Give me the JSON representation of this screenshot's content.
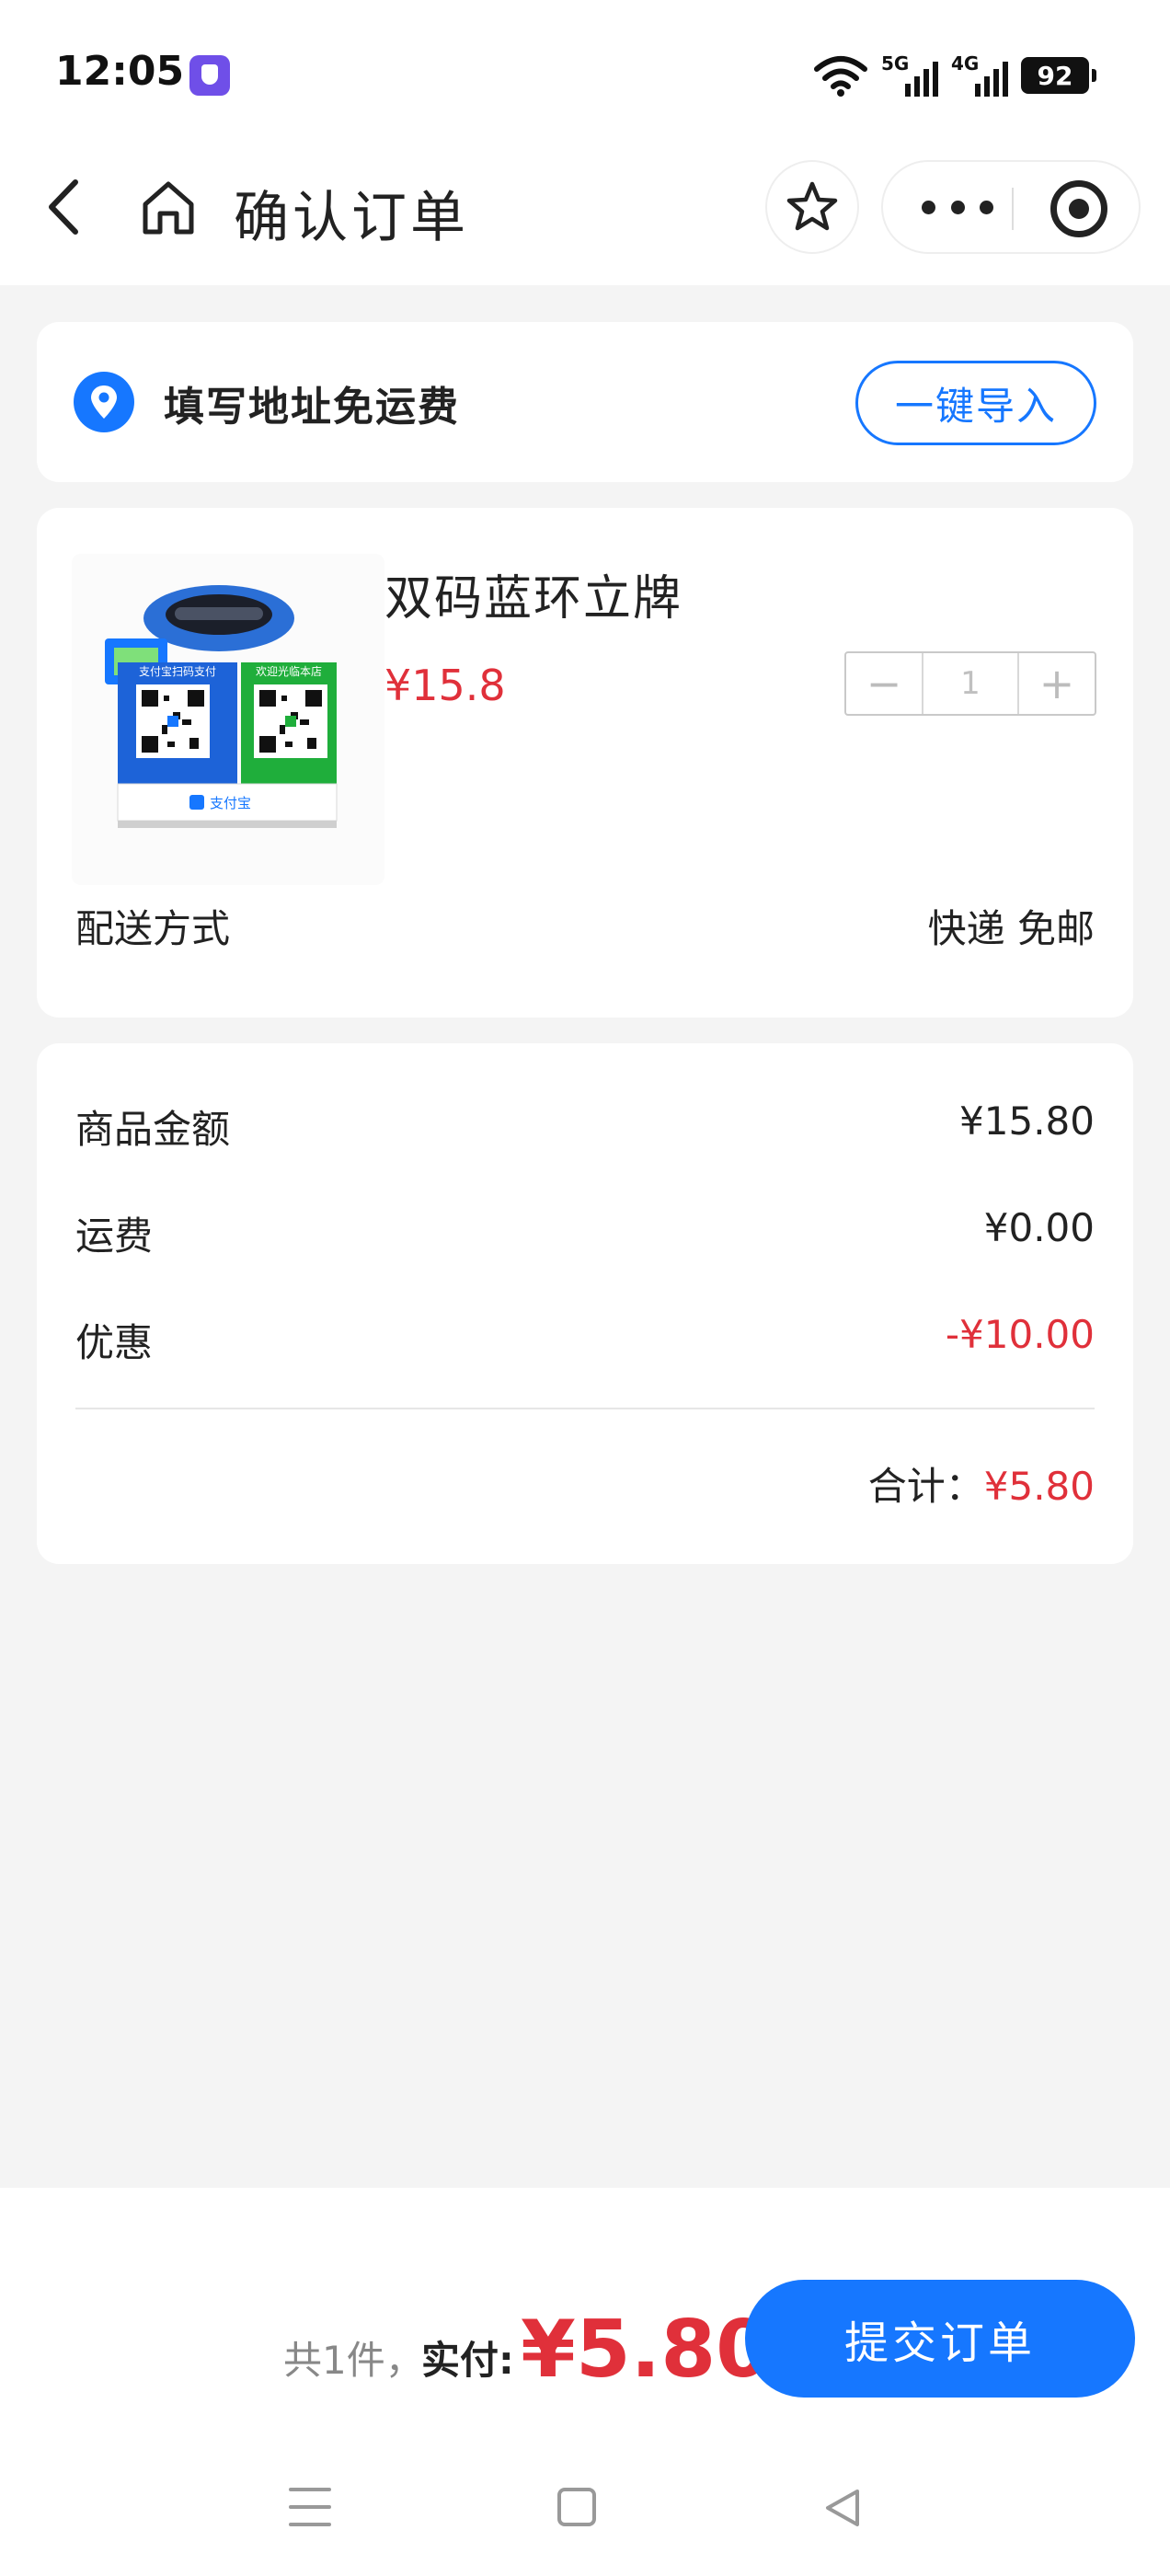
{
  "status_bar": {
    "time": "12:05",
    "sim1_label": "5G",
    "sim2_label": "4G",
    "battery": "92",
    "icons": [
      "shield-app-icon",
      "wifi-icon",
      "signal-icon",
      "battery-icon"
    ]
  },
  "nav": {
    "title": "确认订单",
    "icons": [
      "back-icon",
      "home-icon",
      "star-icon",
      "more-icon",
      "target-icon"
    ]
  },
  "address": {
    "prompt": "填写地址免运费",
    "import_button": "一键导入",
    "icon": "location-pin-icon"
  },
  "product": {
    "name": "双码蓝环立牌",
    "price": "¥15.8",
    "quantity": "1",
    "minus": "−",
    "plus": "+",
    "image_texts": {
      "left_panel": "支付宝扫码支付",
      "right_panel": "欢迎光临本店",
      "footer": "支付宝"
    },
    "shipping_label": "配送方式",
    "shipping_value": "快递 免邮"
  },
  "summary": {
    "rows": [
      {
        "label": "商品金额",
        "value": "¥15.80"
      },
      {
        "label": "运费",
        "value": "¥0.00"
      },
      {
        "label": "优惠",
        "value": "-¥10.00"
      }
    ],
    "total_label": "合计：",
    "total_value": "¥5.80"
  },
  "bottom": {
    "count": "共1件，",
    "paid_label": "实付:",
    "paid_amount": "¥5.80",
    "submit": "提交订单"
  },
  "colors": {
    "accent": "#1677ff",
    "price_red": "#e0303a",
    "background": "#f4f4f4"
  }
}
